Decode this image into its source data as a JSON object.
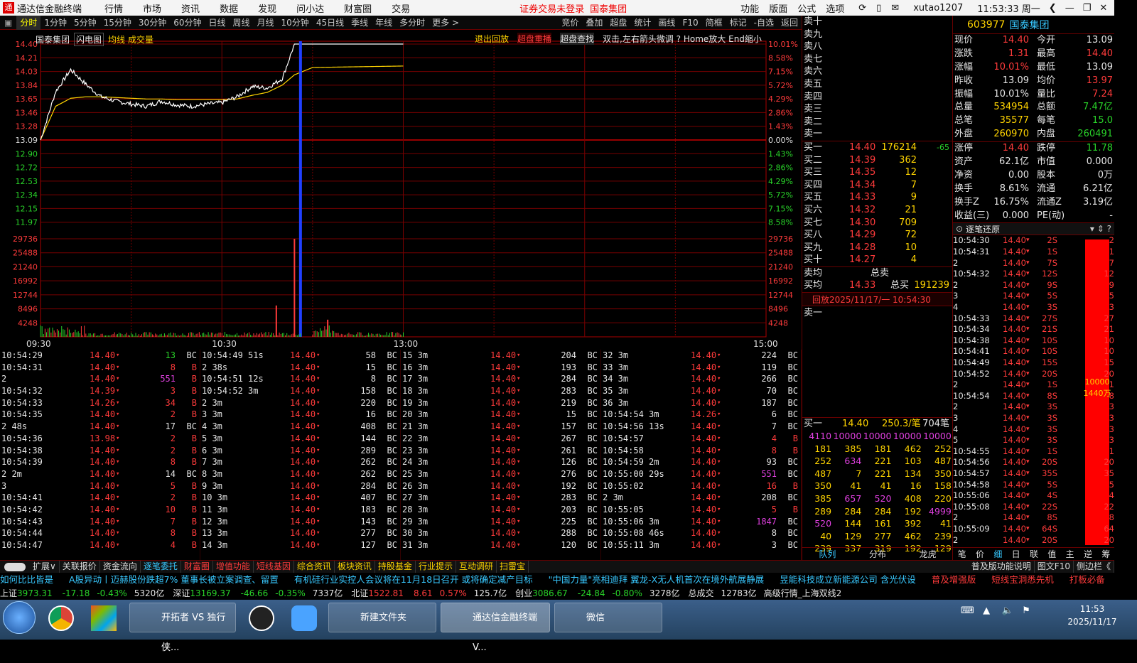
{
  "titlebar": {
    "app": "通达信金融终端",
    "menus": [
      "行情",
      "市场",
      "资讯",
      "数据",
      "发现",
      "问小达",
      "财富圈",
      "交易"
    ],
    "notice1": "证券交易未登录",
    "notice2": "国泰集团",
    "right_menus": [
      "功能",
      "版面",
      "公式",
      "选项"
    ],
    "user": "xutao1207",
    "time": "11:53:33 周一"
  },
  "tabs": [
    "分时",
    "1分钟",
    "5分钟",
    "15分钟",
    "30分钟",
    "60分钟",
    "日线",
    "周线",
    "月线",
    "10分钟",
    "45日线",
    "季线",
    "年线",
    "多分时",
    "更多 >"
  ],
  "tabs_right": [
    "竞价",
    "叠加",
    "超盘",
    "统计",
    "画线",
    "F10",
    "简框",
    "标记",
    "-自选",
    "返回"
  ],
  "chart_head": {
    "name": "国泰集团",
    "flash": "闪电图",
    "avg": "均线",
    "vol": "成交量",
    "links": [
      "退出回放",
      "超盘重播",
      "超盘查找"
    ],
    "hint": "双击,左右箭头微调  ?  Home放大 End缩小"
  },
  "chart_data": {
    "type": "line",
    "title": "",
    "series": [
      {
        "name": "均线"
      }
    ],
    "price_ticks": [
      "14.40",
      "14.21",
      "14.03",
      "13.84",
      "13.65",
      "13.46",
      "13.28",
      "13.09",
      "12.90",
      "12.72",
      "12.53",
      "12.34",
      "12.15",
      "11.97"
    ],
    "pct_ticks": [
      "10.01%",
      "8.58%",
      "7.15%",
      "5.72%",
      "4.29%",
      "2.86%",
      "1.43%",
      "0.00%",
      "1.43%",
      "2.86%",
      "4.29%",
      "5.72%",
      "7.15%",
      "8.58%"
    ],
    "vol_ticks": [
      "29736",
      "25488",
      "21240",
      "16992",
      "12744",
      "8496",
      "4248"
    ],
    "time_ticks": [
      "09:30",
      "10:30",
      "13:00",
      "15:00"
    ],
    "ylim": [
      11.78,
      14.4
    ],
    "prev_close": 13.09,
    "price_time": [
      "09:30",
      "09:35",
      "09:40",
      "09:45",
      "09:50",
      "09:55",
      "10:00",
      "10:05",
      "10:10",
      "10:15",
      "10:20",
      "10:25",
      "10:30",
      "10:35",
      "10:40",
      "10:45",
      "10:50",
      "10:54",
      "11:00",
      "11:30"
    ],
    "price": [
      13.09,
      13.75,
      14.05,
      13.85,
      13.68,
      13.62,
      13.58,
      13.55,
      13.62,
      13.57,
      13.55,
      13.58,
      13.6,
      13.68,
      13.82,
      13.8,
      13.93,
      14.4,
      14.4,
      14.4
    ],
    "avg": [
      13.09,
      13.55,
      13.66,
      13.68,
      13.68,
      13.67,
      13.66,
      13.65,
      13.65,
      13.64,
      13.64,
      13.64,
      13.64,
      13.65,
      13.7,
      13.74,
      13.84,
      13.98,
      14.08,
      14.1
    ],
    "volume_spikes": [
      {
        "time": "10:48",
        "value": 9500
      },
      {
        "time": "10:54",
        "value": 29736
      },
      {
        "time": "11:05",
        "value": 5200
      }
    ]
  },
  "ticks": [
    [
      [
        "10:54:29",
        "14.40",
        "13",
        "BC",
        "dn"
      ],
      [
        "10:54:31",
        "14.40",
        "8",
        "B",
        "up"
      ],
      [
        "2",
        "14.40",
        "551",
        "B",
        "mg"
      ],
      [
        "10:54:32",
        "14.39",
        "3",
        "B",
        "up"
      ],
      [
        "10:54:33",
        "14.26",
        "34",
        "B",
        "up"
      ],
      [
        "10:54:35",
        "14.40",
        "2",
        "B",
        "up"
      ],
      [
        "2 48s",
        "14.40",
        "17",
        "BC",
        "wh"
      ],
      [
        "10:54:36",
        "13.98",
        "2",
        "B",
        "up"
      ],
      [
        "10:54:38",
        "14.40",
        "2",
        "B",
        "up"
      ],
      [
        "10:54:39",
        "14.40",
        "8",
        "B",
        "up"
      ],
      [
        "2 2m",
        "14.40",
        "14",
        "BC",
        "wh"
      ],
      [
        "3",
        "14.40",
        "5",
        "B",
        "up"
      ],
      [
        "10:54:41",
        "14.40",
        "2",
        "B",
        "up"
      ],
      [
        "10:54:42",
        "14.40",
        "10",
        "B",
        "up"
      ],
      [
        "10:54:43",
        "14.40",
        "7",
        "B",
        "up"
      ],
      [
        "10:54:44",
        "14.40",
        "8",
        "B",
        "up"
      ],
      [
        "10:54:47",
        "14.40",
        "4",
        "B",
        "up"
      ]
    ],
    [
      [
        "10:54:49 51s",
        "14.40",
        "58",
        "BC",
        "wh"
      ],
      [
        "2 38s",
        "14.40",
        "15",
        "BC",
        "wh"
      ],
      [
        "10:54:51 12s",
        "14.40",
        "8",
        "BC",
        "wh"
      ],
      [
        "10:54:52 3m",
        "14.40",
        "158",
        "BC",
        "wh"
      ],
      [
        "2 3m",
        "14.40",
        "220",
        "BC",
        "wh"
      ],
      [
        "3 3m",
        "14.40",
        "16",
        "BC",
        "wh"
      ],
      [
        "4 3m",
        "14.40",
        "408",
        "BC",
        "wh"
      ],
      [
        "5 3m",
        "14.40",
        "144",
        "BC",
        "wh"
      ],
      [
        "6 3m",
        "14.40",
        "289",
        "BC",
        "wh"
      ],
      [
        "7 3m",
        "14.40",
        "262",
        "BC",
        "wh"
      ],
      [
        "8 3m",
        "14.40",
        "262",
        "BC",
        "wh"
      ],
      [
        "9 3m",
        "14.40",
        "284",
        "BC",
        "wh"
      ],
      [
        "10 3m",
        "14.40",
        "407",
        "BC",
        "wh"
      ],
      [
        "11 3m",
        "14.40",
        "183",
        "BC",
        "wh"
      ],
      [
        "12 3m",
        "14.40",
        "143",
        "BC",
        "wh"
      ],
      [
        "13 3m",
        "14.40",
        "277",
        "BC",
        "wh"
      ],
      [
        "14 3m",
        "14.40",
        "127",
        "BC",
        "wh"
      ]
    ],
    [
      [
        "15 3m",
        "14.40",
        "204",
        "BC",
        "wh"
      ],
      [
        "16 3m",
        "14.40",
        "193",
        "BC",
        "wh"
      ],
      [
        "17 3m",
        "14.40",
        "284",
        "BC",
        "wh"
      ],
      [
        "18 3m",
        "14.40",
        "283",
        "BC",
        "wh"
      ],
      [
        "19 3m",
        "14.40",
        "219",
        "BC",
        "wh"
      ],
      [
        "20 3m",
        "14.40",
        "15",
        "BC",
        "wh"
      ],
      [
        "21 3m",
        "14.40",
        "157",
        "BC",
        "wh"
      ],
      [
        "22 3m",
        "14.40",
        "267",
        "BC",
        "wh"
      ],
      [
        "23 3m",
        "14.40",
        "261",
        "BC",
        "wh"
      ],
      [
        "24 3m",
        "14.40",
        "126",
        "BC",
        "wh"
      ],
      [
        "25 3m",
        "14.40",
        "276",
        "BC",
        "wh"
      ],
      [
        "26 3m",
        "14.40",
        "192",
        "BC",
        "wh"
      ],
      [
        "27 3m",
        "14.40",
        "283",
        "BC",
        "wh"
      ],
      [
        "28 3m",
        "14.40",
        "203",
        "BC",
        "wh"
      ],
      [
        "29 3m",
        "14.40",
        "225",
        "BC",
        "wh"
      ],
      [
        "30 3m",
        "14.40",
        "288",
        "BC",
        "wh"
      ],
      [
        "31 3m",
        "14.40",
        "120",
        "BC",
        "wh"
      ]
    ],
    [
      [
        "32 3m",
        "14.40",
        "224",
        "BC",
        "wh"
      ],
      [
        "33 3m",
        "14.40",
        "119",
        "BC",
        "wh"
      ],
      [
        "34 3m",
        "14.40",
        "266",
        "BC",
        "wh"
      ],
      [
        "35 3m",
        "14.40",
        "70",
        "BC",
        "wh"
      ],
      [
        "36 3m",
        "14.40",
        "187",
        "BC",
        "wh"
      ],
      [
        "10:54:54 3m",
        "14.26",
        "6",
        "BC",
        "wh"
      ],
      [
        "10:54:56 13s",
        "14.40",
        "7",
        "BC",
        "wh"
      ],
      [
        "10:54:57",
        "14.40",
        "4",
        "B",
        "up"
      ],
      [
        "10:54:58",
        "14.40",
        "8",
        "B",
        "up"
      ],
      [
        "10:54:59 2m",
        "14.40",
        "93",
        "BC",
        "wh"
      ],
      [
        "10:55:00 29s",
        "14.40",
        "551",
        "BC",
        "mg"
      ],
      [
        "10:55:02",
        "14.40",
        "16",
        "B",
        "up"
      ],
      [
        "2 3m",
        "14.40",
        "208",
        "BC",
        "wh"
      ],
      [
        "10:55:05",
        "14.40",
        "5",
        "B",
        "up"
      ],
      [
        "10:55:06 3m",
        "14.40",
        "1847",
        "BC",
        "mg"
      ],
      [
        "10:55:08 46s",
        "14.40",
        "8",
        "BC",
        "wh"
      ],
      [
        "10:55:11 3m",
        "14.40",
        "3",
        "BC",
        "wh"
      ]
    ]
  ],
  "orderbook": {
    "sells": [
      "卖十",
      "卖九",
      "卖八",
      "卖七",
      "卖六",
      "卖五",
      "卖四",
      "卖三",
      "卖二",
      "卖一"
    ],
    "buys": [
      [
        "买一",
        "14.40",
        "176214",
        "-65"
      ],
      [
        "买二",
        "14.39",
        "362",
        ""
      ],
      [
        "买三",
        "14.35",
        "12",
        ""
      ],
      [
        "买四",
        "14.34",
        "7",
        ""
      ],
      [
        "买五",
        "14.33",
        "9",
        ""
      ],
      [
        "买六",
        "14.32",
        "21",
        ""
      ],
      [
        "买七",
        "14.30",
        "709",
        ""
      ],
      [
        "买八",
        "14.29",
        "72",
        ""
      ],
      [
        "买九",
        "14.28",
        "10",
        ""
      ],
      [
        "买十",
        "14.27",
        "4",
        ""
      ]
    ],
    "sell_avg": "卖均",
    "total_sell": "总卖",
    "buy_avg": "买均",
    "buy_avg_val": "14.33",
    "total_buy": "总买",
    "total_buy_val": "191239",
    "replay": "回放2025/11/17/一 10:54:30",
    "sell_one": "卖一",
    "buy_one_label": "买一",
    "buy_one_price": "14.40",
    "per_order": "250.3/笔",
    "orders": "704笔",
    "queue": [
      [
        "4110",
        "10000",
        "10000",
        "10000",
        "10000"
      ],
      [
        "181",
        "385",
        "181",
        "462",
        "252"
      ],
      [
        "252",
        "634",
        "221",
        "103",
        "487"
      ],
      [
        "487",
        "7",
        "221",
        "134",
        "350"
      ],
      [
        "350",
        "41",
        "41",
        "16",
        "158"
      ],
      [
        "385",
        "657",
        "520",
        "408",
        "220"
      ],
      [
        "289",
        "284",
        "284",
        "192",
        "4999"
      ],
      [
        "520",
        "144",
        "161",
        "392",
        "41"
      ],
      [
        "40",
        "129",
        "277",
        "462",
        "239"
      ],
      [
        "239",
        "337",
        "319",
        "192",
        "129"
      ]
    ],
    "tabs": [
      "队列",
      "分布",
      "龙虎"
    ]
  },
  "quote": {
    "code": "603977",
    "name": "国泰集团",
    "rows": [
      [
        "现价",
        "14.40",
        "今开",
        "13.09"
      ],
      [
        "涨跌",
        "1.31",
        "最高",
        "14.40"
      ],
      [
        "涨幅",
        "10.01%",
        "最低",
        "13.09"
      ],
      [
        "昨收",
        "13.09",
        "均价",
        "13.97"
      ],
      [
        "振幅",
        "10.01%",
        "量比",
        "7.24"
      ],
      [
        "总量",
        "534954",
        "总额",
        "7.47亿"
      ],
      [
        "总笔",
        "35577",
        "每笔",
        "15.0"
      ],
      [
        "外盘",
        "260970",
        "内盘",
        "260491"
      ]
    ],
    "rows2": [
      [
        "涨停",
        "14.40",
        "跌停",
        "11.78"
      ],
      [
        "资产",
        "62.1亿",
        "市值",
        "0.000"
      ],
      [
        "净资",
        "0.00",
        "股本",
        "0万"
      ],
      [
        "换手",
        "8.61%",
        "流通",
        "6.21亿"
      ],
      [
        "换手Z",
        "16.75%",
        "流通Z",
        "3.19亿"
      ],
      [
        "收益(三)",
        "0.000",
        "PE(动)",
        "-"
      ]
    ],
    "detail_title": "逐笔还原",
    "detail": [
      [
        "10:54:30",
        "14.40",
        "2S",
        "2"
      ],
      [
        "10:54:31",
        "14.40",
        "1S",
        "1"
      ],
      [
        "2",
        "14.40",
        "7S",
        "7"
      ],
      [
        "10:54:32",
        "14.40",
        "12S",
        "12"
      ],
      [
        "2",
        "14.40",
        "9S",
        "9"
      ],
      [
        "3",
        "14.40",
        "5S",
        "5"
      ],
      [
        "4",
        "14.40",
        "3S",
        "3"
      ],
      [
        "10:54:33",
        "14.40",
        "27S",
        "27"
      ],
      [
        "10:54:34",
        "14.40",
        "21S",
        "21"
      ],
      [
        "10:54:38",
        "14.40",
        "10S",
        "10"
      ],
      [
        "10:54:41",
        "14.40",
        "10S",
        "10"
      ],
      [
        "10:54:49",
        "14.40",
        "15S",
        "15"
      ],
      [
        "10:54:52",
        "14.40",
        "20S",
        "20"
      ],
      [
        "2",
        "14.40",
        "1S",
        "1"
      ],
      [
        "10:54:54",
        "14.40",
        "8S",
        "8"
      ],
      [
        "2",
        "14.40",
        "3S",
        "3"
      ],
      [
        "3",
        "14.40",
        "3S",
        "3"
      ],
      [
        "4",
        "14.40",
        "3S",
        "3"
      ],
      [
        "5",
        "14.40",
        "3S",
        "3"
      ],
      [
        "10:54:55",
        "14.40",
        "1S",
        "1"
      ],
      [
        "10:54:56",
        "14.40",
        "20S",
        "20"
      ],
      [
        "10:54:57",
        "14.40",
        "35S",
        "35"
      ],
      [
        "10:54:58",
        "14.40",
        "5S",
        "5"
      ],
      [
        "10:55:06",
        "14.40",
        "4S",
        "4"
      ],
      [
        "10:55:08",
        "14.40",
        "22S",
        "22"
      ],
      [
        "2",
        "14.40",
        "8S",
        "8"
      ],
      [
        "10:55:09",
        "14.40",
        "64S",
        "64"
      ],
      [
        "2",
        "14.40",
        "20S",
        "20"
      ]
    ],
    "bar_label1": "10000",
    "bar_label2": "1440万",
    "bottom_tabs": [
      "笔",
      "价",
      "细",
      "日",
      "联",
      "值",
      "主",
      "逆",
      "筹"
    ]
  },
  "botbar": [
    "扩展∨",
    "关联报价",
    "资金流向",
    "逐笔委托",
    "财富圈",
    "增值功能",
    "短线基因",
    "综合资讯",
    "板块资讯",
    "持股基金",
    "行业提示",
    "互动调研",
    "扫雷宝"
  ],
  "botbar_right": [
    "普及版功能说明",
    "图文F10",
    "侧边栏《"
  ],
  "ticker": [
    [
      "如何比比皆是",
      "cy"
    ],
    [
      "A股异动丨迈赫股份跌超7%  董事长被立案调查、留置",
      "cy"
    ],
    [
      "有机硅行业实控人会议将在11月18日召开  或将确定减产目标",
      "cy"
    ],
    [
      "\"中国力量\"亮相迪拜  翼龙-X无人机首次在境外航展静展",
      "cy"
    ],
    [
      "昱能科技成立新能源公司  含光伏设",
      "cy"
    ],
    [
      "普及增强版",
      "up"
    ],
    [
      "短线宝洞悉先机",
      "up"
    ],
    [
      "打板必备",
      "up"
    ]
  ],
  "indices": [
    [
      "上证",
      "3973.31",
      "-17.18",
      "-0.43%",
      "5320亿"
    ],
    [
      "深证",
      "13169.37",
      "-46.66",
      "-0.35%",
      "7337亿"
    ],
    [
      "北证",
      "1522.81",
      "8.61",
      "0.57%",
      "125.7亿"
    ],
    [
      "创业",
      "3086.67",
      "-24.84",
      "-0.80%",
      "3278亿"
    ]
  ],
  "idx_extra": [
    "总成交",
    "12783亿",
    "高级行情_上海双线2"
  ],
  "taskbar": {
    "items": [
      "开拓者 VS 独行侠...",
      "新建文件夹",
      "通达信金融终端V...",
      "微信"
    ],
    "time": "11:53",
    "date": "2025/11/17"
  }
}
